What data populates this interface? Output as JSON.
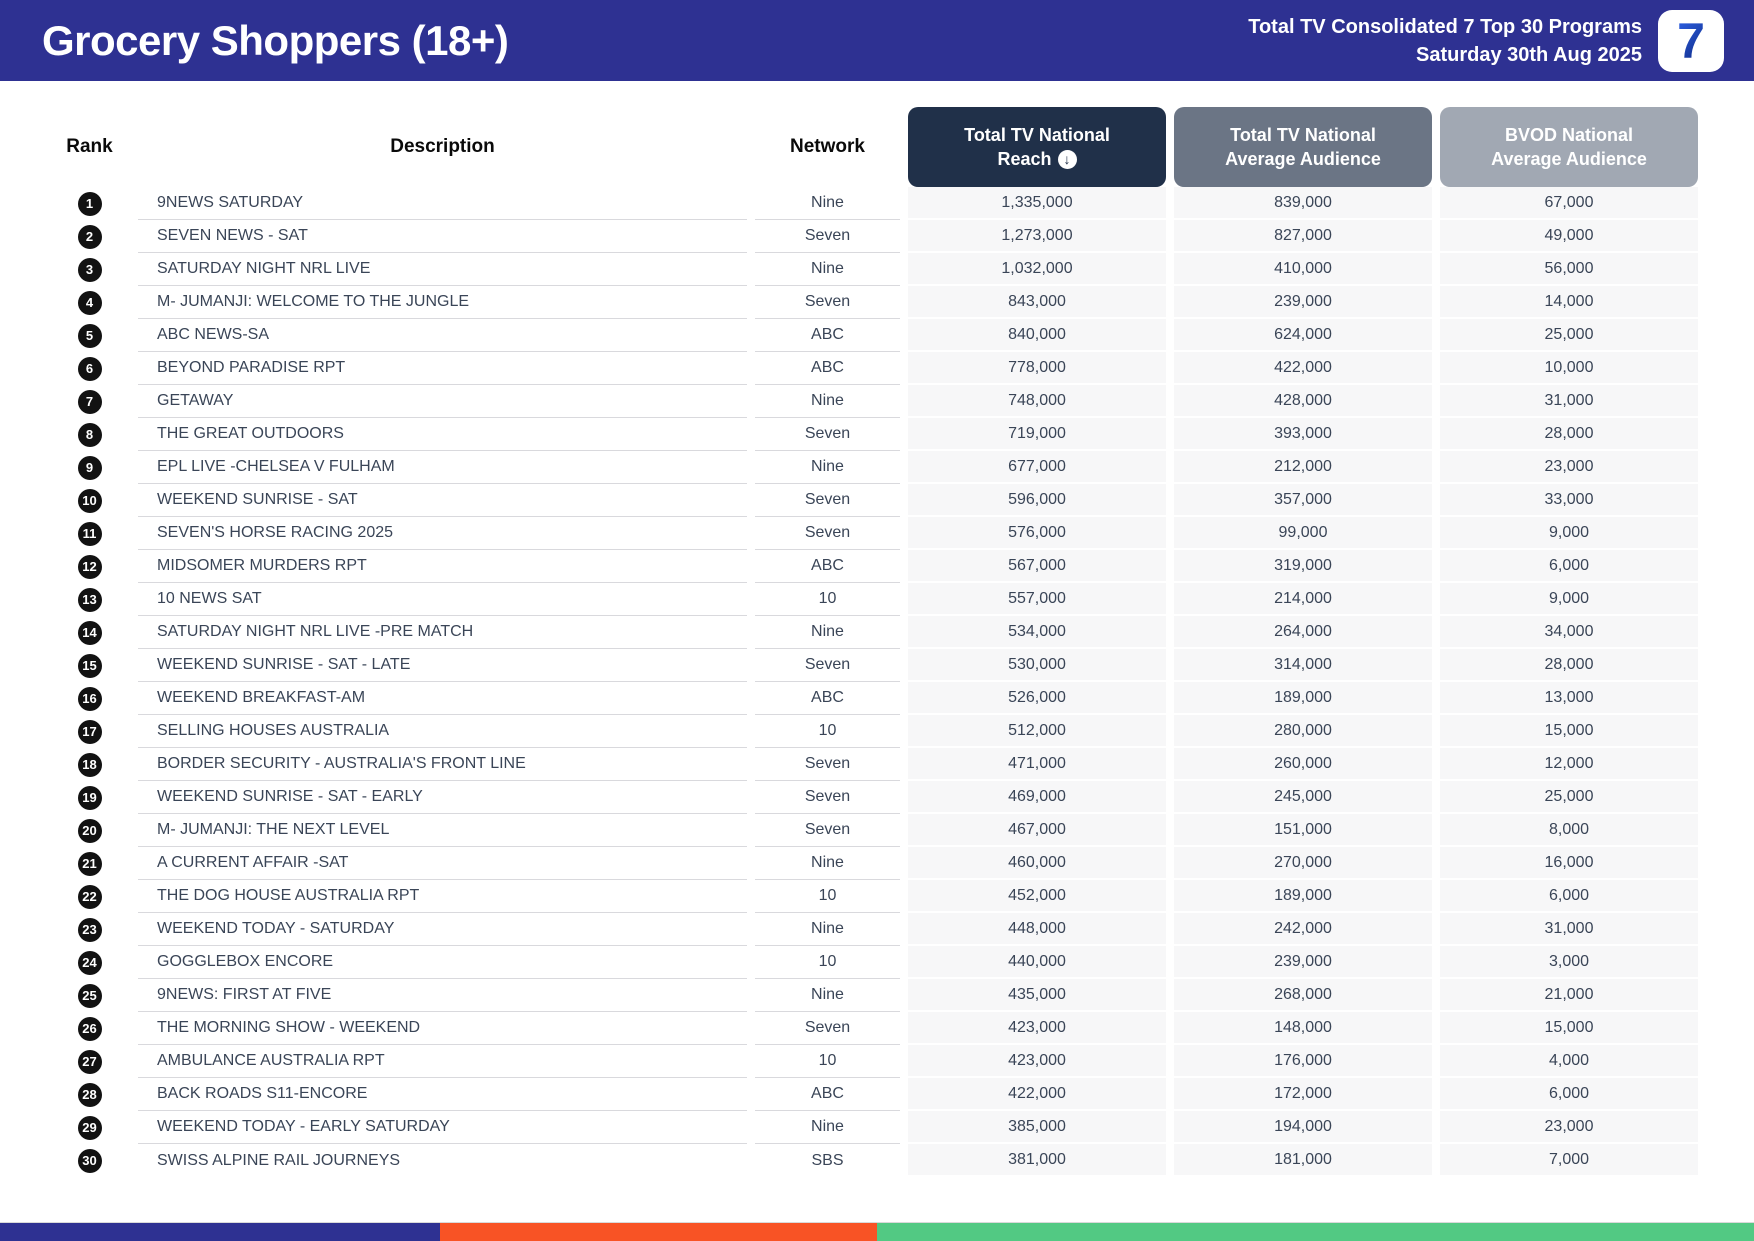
{
  "header": {
    "title": "Grocery Shoppers (18+)",
    "subtitle_line1": "Total TV Consolidated 7 Top 30 Programs",
    "subtitle_line2": "Saturday 30th Aug 2025",
    "logo_text": "7"
  },
  "table": {
    "plain_columns": {
      "rank": "Rank",
      "description": "Description",
      "network": "Network"
    },
    "value_columns": [
      {
        "line1": "Total TV National",
        "line2": "Reach",
        "sort_icon": "arrow-down-circle",
        "sort_glyph": "↓"
      },
      {
        "line1": "Total TV National",
        "line2": "Average Audience"
      },
      {
        "line1": "BVOD National",
        "line2": "Average Audience"
      }
    ],
    "rows": [
      {
        "rank": "1",
        "description": "9NEWS SATURDAY",
        "network": "Nine",
        "reach": "1,335,000",
        "avg_audience": "839,000",
        "bvod_audience": "67,000"
      },
      {
        "rank": "2",
        "description": "SEVEN NEWS - SAT",
        "network": "Seven",
        "reach": "1,273,000",
        "avg_audience": "827,000",
        "bvod_audience": "49,000"
      },
      {
        "rank": "3",
        "description": "SATURDAY NIGHT NRL LIVE",
        "network": "Nine",
        "reach": "1,032,000",
        "avg_audience": "410,000",
        "bvod_audience": "56,000"
      },
      {
        "rank": "4",
        "description": "M- JUMANJI: WELCOME TO THE JUNGLE",
        "network": "Seven",
        "reach": "843,000",
        "avg_audience": "239,000",
        "bvod_audience": "14,000"
      },
      {
        "rank": "5",
        "description": "ABC NEWS-SA",
        "network": "ABC",
        "reach": "840,000",
        "avg_audience": "624,000",
        "bvod_audience": "25,000"
      },
      {
        "rank": "6",
        "description": "BEYOND PARADISE RPT",
        "network": "ABC",
        "reach": "778,000",
        "avg_audience": "422,000",
        "bvod_audience": "10,000"
      },
      {
        "rank": "7",
        "description": "GETAWAY",
        "network": "Nine",
        "reach": "748,000",
        "avg_audience": "428,000",
        "bvod_audience": "31,000"
      },
      {
        "rank": "8",
        "description": "THE GREAT OUTDOORS",
        "network": "Seven",
        "reach": "719,000",
        "avg_audience": "393,000",
        "bvod_audience": "28,000"
      },
      {
        "rank": "9",
        "description": "EPL LIVE -CHELSEA V FULHAM",
        "network": "Nine",
        "reach": "677,000",
        "avg_audience": "212,000",
        "bvod_audience": "23,000"
      },
      {
        "rank": "10",
        "description": "WEEKEND SUNRISE - SAT",
        "network": "Seven",
        "reach": "596,000",
        "avg_audience": "357,000",
        "bvod_audience": "33,000"
      },
      {
        "rank": "11",
        "description": "SEVEN'S HORSE RACING 2025",
        "network": "Seven",
        "reach": "576,000",
        "avg_audience": "99,000",
        "bvod_audience": "9,000"
      },
      {
        "rank": "12",
        "description": "MIDSOMER MURDERS RPT",
        "network": "ABC",
        "reach": "567,000",
        "avg_audience": "319,000",
        "bvod_audience": "6,000"
      },
      {
        "rank": "13",
        "description": "10 NEWS SAT",
        "network": "10",
        "reach": "557,000",
        "avg_audience": "214,000",
        "bvod_audience": "9,000"
      },
      {
        "rank": "14",
        "description": "SATURDAY NIGHT NRL LIVE -PRE MATCH",
        "network": "Nine",
        "reach": "534,000",
        "avg_audience": "264,000",
        "bvod_audience": "34,000"
      },
      {
        "rank": "15",
        "description": "WEEKEND SUNRISE - SAT - LATE",
        "network": "Seven",
        "reach": "530,000",
        "avg_audience": "314,000",
        "bvod_audience": "28,000"
      },
      {
        "rank": "16",
        "description": "WEEKEND BREAKFAST-AM",
        "network": "ABC",
        "reach": "526,000",
        "avg_audience": "189,000",
        "bvod_audience": "13,000"
      },
      {
        "rank": "17",
        "description": "SELLING HOUSES AUSTRALIA",
        "network": "10",
        "reach": "512,000",
        "avg_audience": "280,000",
        "bvod_audience": "15,000"
      },
      {
        "rank": "18",
        "description": "BORDER SECURITY - AUSTRALIA'S FRONT LINE",
        "network": "Seven",
        "reach": "471,000",
        "avg_audience": "260,000",
        "bvod_audience": "12,000"
      },
      {
        "rank": "19",
        "description": "WEEKEND SUNRISE - SAT - EARLY",
        "network": "Seven",
        "reach": "469,000",
        "avg_audience": "245,000",
        "bvod_audience": "25,000"
      },
      {
        "rank": "20",
        "description": "M- JUMANJI: THE NEXT LEVEL",
        "network": "Seven",
        "reach": "467,000",
        "avg_audience": "151,000",
        "bvod_audience": "8,000"
      },
      {
        "rank": "21",
        "description": "A CURRENT AFFAIR -SAT",
        "network": "Nine",
        "reach": "460,000",
        "avg_audience": "270,000",
        "bvod_audience": "16,000"
      },
      {
        "rank": "22",
        "description": "THE DOG HOUSE AUSTRALIA RPT",
        "network": "10",
        "reach": "452,000",
        "avg_audience": "189,000",
        "bvod_audience": "6,000"
      },
      {
        "rank": "23",
        "description": "WEEKEND TODAY - SATURDAY",
        "network": "Nine",
        "reach": "448,000",
        "avg_audience": "242,000",
        "bvod_audience": "31,000"
      },
      {
        "rank": "24",
        "description": "GOGGLEBOX ENCORE",
        "network": "10",
        "reach": "440,000",
        "avg_audience": "239,000",
        "bvod_audience": "3,000"
      },
      {
        "rank": "25",
        "description": "9NEWS: FIRST AT FIVE",
        "network": "Nine",
        "reach": "435,000",
        "avg_audience": "268,000",
        "bvod_audience": "21,000"
      },
      {
        "rank": "26",
        "description": "THE MORNING SHOW - WEEKEND",
        "network": "Seven",
        "reach": "423,000",
        "avg_audience": "148,000",
        "bvod_audience": "15,000"
      },
      {
        "rank": "27",
        "description": "AMBULANCE AUSTRALIA RPT",
        "network": "10",
        "reach": "423,000",
        "avg_audience": "176,000",
        "bvod_audience": "4,000"
      },
      {
        "rank": "28",
        "description": "BACK ROADS S11-ENCORE",
        "network": "ABC",
        "reach": "422,000",
        "avg_audience": "172,000",
        "bvod_audience": "6,000"
      },
      {
        "rank": "29",
        "description": "WEEKEND TODAY - EARLY SATURDAY",
        "network": "Nine",
        "reach": "385,000",
        "avg_audience": "194,000",
        "bvod_audience": "23,000"
      },
      {
        "rank": "30",
        "description": "SWISS ALPINE RAIL JOURNEYS",
        "network": "SBS",
        "reach": "381,000",
        "avg_audience": "181,000",
        "bvod_audience": "7,000"
      }
    ]
  },
  "colors": {
    "banner_blue": "#2E3192",
    "header_dark": "#203049",
    "header_mid": "#6B7585",
    "header_light": "#A1A8B3",
    "cell_bg": "#F7F7F8",
    "text": "#3A4557",
    "stripe_blue": "#2E3192",
    "stripe_orange": "#F85325",
    "stripe_green": "#52C983"
  },
  "footer": {
    "stripe_segments": [
      "#2E3192",
      "#F85325",
      "#52C983"
    ]
  }
}
